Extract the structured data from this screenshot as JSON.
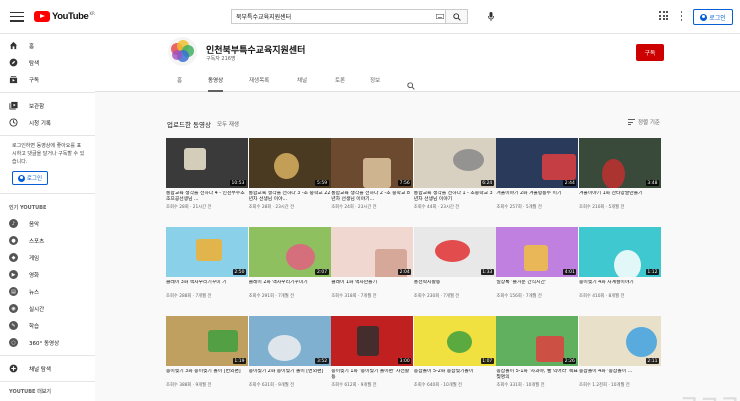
{
  "topbar": {
    "logo_text": "YouTube",
    "logo_region": "KR",
    "search_value": "북부특수교육지원센터",
    "login_label": "로그인"
  },
  "sidebar": {
    "nav": [
      {
        "label": "홈",
        "icon": "home-icon"
      },
      {
        "label": "탐색",
        "icon": "compass-icon"
      },
      {
        "label": "구독",
        "icon": "subscriptions-icon"
      }
    ],
    "library": [
      {
        "label": "보관함",
        "icon": "library-icon"
      },
      {
        "label": "시청 기록",
        "icon": "history-icon"
      }
    ],
    "login_note": "로그인하면 동영상에 좋아요를 표시하고 댓글을 달거나 구독할 수 있습니다.",
    "login_label": "로그인",
    "popular_heading": "인기 YOUTUBE",
    "categories": [
      {
        "label": "음악",
        "glyph": "♪"
      },
      {
        "label": "스포츠",
        "glyph": "●"
      },
      {
        "label": "게임",
        "glyph": "◆"
      },
      {
        "label": "영화",
        "glyph": "▶"
      },
      {
        "label": "뉴스",
        "glyph": "▤"
      },
      {
        "label": "실시간",
        "glyph": "◉"
      },
      {
        "label": "학습",
        "glyph": "✎"
      },
      {
        "label": "360° 동영상",
        "glyph": "○"
      }
    ],
    "browse_channels": "채널 탐색",
    "more_heading": "YOUTUBE 더보기"
  },
  "channel": {
    "name": "인천북부특수교육지원센터",
    "subscribers": "구독자 216명",
    "subscribe_label": "구독",
    "tabs": [
      "홈",
      "동영상",
      "재생목록",
      "채널",
      "토론",
      "정보"
    ],
    "active_tab": 1
  },
  "section": {
    "title": "업로드한 동영상",
    "play_all": "모두 재생",
    "sort_label": "정렬 기준"
  },
  "videos": [
    {
      "title": "통합교육 생각을 전하다 4 - 인천부수초 조으공선생님 ...",
      "meta": "조회수 28회 · 21시간 전",
      "duration": "10:53",
      "bg": "#3a3a3a",
      "accent": "#f0e8d0"
    },
    {
      "title": "통합교육 생각을 전하다 3 -초 중학교 22년차 선생님 이야...",
      "meta": "조회수 28회 · 23시간 전",
      "duration": "5:59",
      "bg": "#4a3a22",
      "accent": "#d8b060"
    },
    {
      "title": "통합교육 생각을 전하다 2 -초 중학교 8년차 선생님 이야기...",
      "meta": "조회수 24회 · 23시간 전",
      "duration": "7:56",
      "bg": "#6b4a30",
      "accent": "#e0c8a0"
    },
    {
      "title": "통합교육 생각을 전하다 1 - 초중학교 3년차 선생님 이야기",
      "meta": "조회수 44회 · 23시간 전",
      "duration": "6:24",
      "bg": "#d8d0c0",
      "accent": "#888888"
    },
    {
      "title": "겨울이야기 2화 겨울렁동두 이기",
      "meta": "조회수 257회 · 5개월 전",
      "duration": "2:44",
      "bg": "#2a3a5a",
      "accent": "#e04040"
    },
    {
      "title": "겨울이야기 1화 산타양말만들기",
      "meta": "조회수 210회 · 5개월 전",
      "duration": "3:48",
      "bg": "#3a4a3a",
      "accent": "#c03030"
    },
    {
      "title": "클레이 3화 액자우리기꾸미 기",
      "meta": "조회수 288회 · 7개월 전",
      "duration": "2:50",
      "bg": "#8ad0e8",
      "accent": "#f0b030"
    },
    {
      "title": "클레이 2화 액자우리기꾸미기",
      "meta": "조회수 291회 · 7개월 전",
      "duration": "2:07",
      "bg": "#8ec060",
      "accent": "#e06080"
    },
    {
      "title": "클레이 1화 액자만들기",
      "meta": "조회수 318회 · 7개월 전",
      "duration": "2:04",
      "bg": "#f0d8d0",
      "accent": "#d0a090"
    },
    {
      "title": "풍선딱지활동",
      "meta": "조회수 230회 · 7개월 전",
      "duration": "1:33",
      "bg": "#e8e8e8",
      "accent": "#e03030"
    },
    {
      "title": "일상톡 '즐거운 간식시간'",
      "meta": "조회수 156회 · 7개월 전",
      "duration": "4:01",
      "bg": "#c080e0",
      "accent": "#f0c040"
    },
    {
      "title": "종이찢기 4화 사계절이야기",
      "meta": "조회수 410회 · 8개월 전",
      "duration": "1:12",
      "bg": "#40c8d0",
      "accent": "#ffffff"
    },
    {
      "title": "종이찢기 3화 종이찢기 놀이 [번외편]",
      "meta": "조회수 388회 · 9개월 전",
      "duration": "1:19",
      "bg": "#c0a060",
      "accent": "#40a040"
    },
    {
      "title": "종이찢기 2화 종이찢기 놀이 [번외편]",
      "meta": "조회수 631회 · 9개월 전",
      "duration": "3:52",
      "bg": "#80b0d0",
      "accent": "#f0f0f0"
    },
    {
      "title": "종이찢기 1화 '종이찢기 놀이편' 사전활동",
      "meta": "조회수 612회 · 9개월 전",
      "duration": "3:00",
      "bg": "#c02020",
      "accent": "#303030"
    },
    {
      "title": "종잡놀이 5-2화 종잡찢기놀이",
      "meta": "조회수 640회 · 10개월 전",
      "duration": "1:07",
      "bg": "#f0e040",
      "accent": "#40a040"
    },
    {
      "title": "종잡놀이 5-1화 '사과야, 빨 익어라' 목표찢명의",
      "meta": "조회수 331회 · 10개월 전",
      "duration": "2:26",
      "bg": "#60b060",
      "accent": "#e04040"
    },
    {
      "title": "종잡놀이 4화 '종잡놀이 ...",
      "meta": "조회수 1.2천회 · 10개월 전",
      "duration": "2:11",
      "bg": "#e8e0c8",
      "accent": "#40a0e0"
    }
  ],
  "watermark": "큐교로닌뉴스"
}
